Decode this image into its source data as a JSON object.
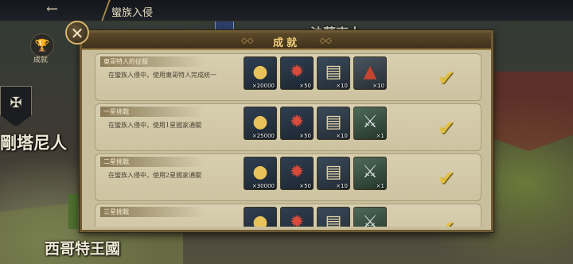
{
  "topbar": {
    "back_icon": "←",
    "title": "蠻族入侵"
  },
  "sidebar": {
    "trophy_icon": "🏆",
    "trophy_label": "成就",
    "shield_icon": "✠"
  },
  "map_labels": [
    "剛塔尼人",
    "西哥特王國",
    "法蘭克人"
  ],
  "panel": {
    "title": "成就",
    "close_icon": "✕",
    "achievements": [
      {
        "title": "東哥特人的征服",
        "desc": "在蠻族入侵中，使用東哥特人完成統一",
        "completed": true,
        "rewards": [
          {
            "icon": "coin-pile-icon",
            "qty": "×20000"
          },
          {
            "icon": "medal-icon",
            "qty": "×50"
          },
          {
            "icon": "scroll-icon",
            "qty": "×10"
          },
          {
            "icon": "camp-icon",
            "qty": "×10"
          }
        ]
      },
      {
        "title": "一星挑戰",
        "desc": "在蠻族入侵中，使用1星國家通關",
        "completed": true,
        "rewards": [
          {
            "icon": "coin-pile-icon",
            "qty": "×25000"
          },
          {
            "icon": "medal-icon",
            "qty": "×50"
          },
          {
            "icon": "scroll-icon",
            "qty": "×10"
          },
          {
            "icon": "sword-icon",
            "qty": "×1"
          }
        ]
      },
      {
        "title": "二星挑戰",
        "desc": "在蠻族入侵中，使用2星國家通關",
        "completed": true,
        "rewards": [
          {
            "icon": "coin-pile-icon",
            "qty": "×30000"
          },
          {
            "icon": "medal-icon",
            "qty": "×50"
          },
          {
            "icon": "scroll-icon",
            "qty": "×10"
          },
          {
            "icon": "sword-icon",
            "qty": "×1"
          }
        ]
      },
      {
        "title": "三星挑戰",
        "desc": "",
        "completed": true,
        "rewards": [
          {
            "icon": "coin-pile-icon",
            "qty": ""
          },
          {
            "icon": "medal-icon",
            "qty": ""
          },
          {
            "icon": "scroll-icon",
            "qty": ""
          },
          {
            "icon": "sword-icon",
            "qty": ""
          }
        ]
      }
    ]
  }
}
